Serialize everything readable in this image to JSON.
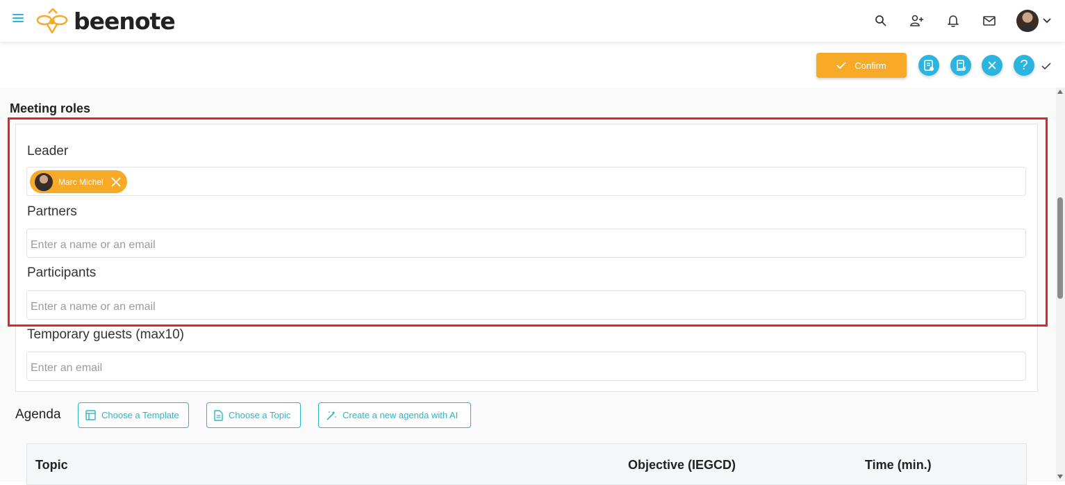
{
  "brand": {
    "name": "beenote"
  },
  "nav": {
    "icons": [
      "search-icon",
      "add-user-icon",
      "bell-icon",
      "mail-icon"
    ]
  },
  "actions": {
    "confirm_label": "Confirm",
    "help_label": "?"
  },
  "meeting_roles": {
    "title": "Meeting roles",
    "leader": {
      "label": "Leader",
      "chips": [
        {
          "name": "Marc Michel"
        }
      ]
    },
    "partners": {
      "label": "Partners",
      "placeholder": "Enter a name or an email"
    },
    "participants": {
      "label": "Participants",
      "placeholder": "Enter a name or an email"
    },
    "temporary_guests": {
      "label": "Temporary guests (max10)",
      "placeholder": "Enter an email"
    }
  },
  "agenda": {
    "title": "Agenda",
    "buttons": {
      "template": "Choose a Template",
      "topic": "Choose a Topic",
      "ai": "Create a new agenda with AI"
    },
    "columns": {
      "topic": "Topic",
      "objective": "Objective (IEGCD)",
      "time": "Time (min.)"
    }
  },
  "colors": {
    "accent_orange": "#f7a928",
    "accent_blue": "#2bb5de",
    "teal": "#2bb5c6",
    "highlight_red": "#e0242b"
  }
}
